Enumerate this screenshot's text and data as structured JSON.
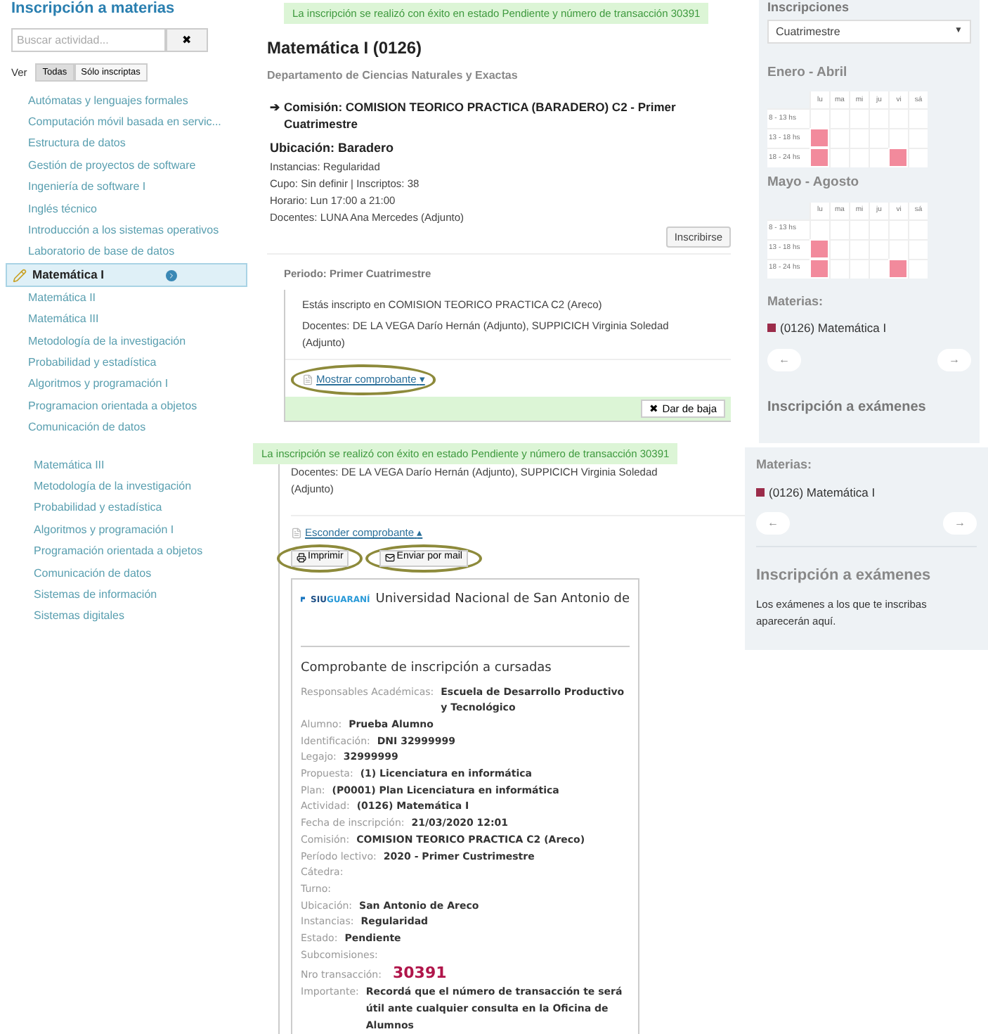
{
  "top": {
    "page_title": "Inscripción a materias",
    "search": {
      "placeholder": "Buscar actividad...",
      "clear": "✖"
    },
    "filter": {
      "label": "Ver",
      "options": [
        {
          "label": "Todas",
          "selected": true
        },
        {
          "label": "Sólo inscriptas",
          "selected": false
        }
      ]
    },
    "subjects": [
      {
        "label": "Autómatas y lenguajes formales",
        "selected": false
      },
      {
        "label": "Computación móvil basada en servic...",
        "selected": false
      },
      {
        "label": "Estructura de datos",
        "selected": false
      },
      {
        "label": "Gestión de proyectos de software",
        "selected": false
      },
      {
        "label": "Ingeniería de software I",
        "selected": false
      },
      {
        "label": "Inglés técnico",
        "selected": false
      },
      {
        "label": "Introducción a los sistemas operativos",
        "selected": false
      },
      {
        "label": "Laboratorio de base de datos",
        "selected": false
      },
      {
        "label": "Matemática I",
        "selected": true
      },
      {
        "label": "Matemática II",
        "selected": false
      },
      {
        "label": "Matemática III",
        "selected": false
      },
      {
        "label": "Metodología de la investigación",
        "selected": false
      },
      {
        "label": "Probabilidad y estadística",
        "selected": false
      },
      {
        "label": "Algoritmos y programación I",
        "selected": false
      },
      {
        "label": "Programacion orientada a objetos",
        "selected": false
      },
      {
        "label": "Comunicación de datos",
        "selected": false
      }
    ],
    "banner": "La inscripción se realizó con éxito en estado Pendiente y número de transacción 30391",
    "course": {
      "title": "Matemática I (0126)",
      "department": "Departamento de Ciencias Naturales y Exactas",
      "commission": {
        "arrow": "➔",
        "title": "Comisión: COMISION TEORICO PRACTICA (BARADERO) C2 - Primer Cuatrimestre",
        "location": "Ubicación: Baradero",
        "details": [
          "Instancias: Regularidad",
          "Cupo: Sin definir | Inscriptos: 38",
          "Horario: Lun 17:00 a 21:00",
          "Docentes: LUNA Ana Mercedes (Adjunto)"
        ],
        "button": "Inscribirse"
      },
      "period": "Periodo: Primer Cuatrimestre",
      "enrolled": {
        "lines": [
          "Estás inscripto en COMISION TEORICO PRACTICA C2 (Areco)",
          "Docentes: DE LA VEGA Darío Hernán (Adjunto), SUPPICICH Virginia Soledad (Adjunto)"
        ],
        "toggle": "Mostrar comprobante",
        "toggle_caret": "▾",
        "drop_icon": "✖",
        "drop_button": "Dar de baja"
      }
    },
    "schedule": {
      "heading": "Inscripciones",
      "select": "Cuatrimestre",
      "select_caret": "▼",
      "calendars": [
        {
          "title": "Enero - Abril",
          "days": [
            "lu",
            "ma",
            "mi",
            "ju",
            "vi",
            "sá"
          ],
          "rows": [
            {
              "label": "8 - 13 hs",
              "cells": [
                false,
                false,
                false,
                false,
                false,
                false
              ]
            },
            {
              "label": "13 - 18 hs",
              "cells": [
                true,
                false,
                false,
                false,
                false,
                false
              ]
            },
            {
              "label": "18 - 24 hs",
              "cells": [
                true,
                false,
                false,
                false,
                true,
                false
              ]
            }
          ]
        },
        {
          "title": "Mayo - Agosto",
          "days": [
            "lu",
            "ma",
            "mi",
            "ju",
            "vi",
            "sá"
          ],
          "rows": [
            {
              "label": "8 - 13 hs",
              "cells": [
                false,
                false,
                false,
                false,
                false,
                false
              ]
            },
            {
              "label": "13 - 18 hs",
              "cells": [
                true,
                false,
                false,
                false,
                false,
                false
              ]
            },
            {
              "label": "18 - 24 hs",
              "cells": [
                true,
                false,
                false,
                false,
                true,
                false
              ]
            }
          ]
        }
      ],
      "subjects_label": "Materias:",
      "legend": [
        {
          "label": "(0126) Matemática I",
          "color": "#9b2c4a"
        }
      ],
      "prev": "←",
      "next": "→",
      "exams_heading": "Inscripción a exámenes"
    }
  },
  "bottom": {
    "subjects": [
      {
        "label": "Matemática III"
      },
      {
        "label": "Metodología de la investigación"
      },
      {
        "label": "Probabilidad y estadística"
      },
      {
        "label": "Algoritmos y programación I"
      },
      {
        "label": "Programación orientada a objetos"
      },
      {
        "label": "Comunicación de datos"
      },
      {
        "label": "Sistemas de información"
      },
      {
        "label": "Sistemas digitales"
      }
    ],
    "banner": "La inscripción se realizó con éxito en estado Pendiente y número de transacción 30391",
    "teachers": "Docentes: DE LA VEGA Darío Hernán (Adjunto), SUPPICICH Virginia Soledad (Adjunto)",
    "toggle": "Esconder comprobante",
    "toggle_caret": "▴",
    "print_button": "Imprimir",
    "mail_button": "Enviar por mail",
    "receipt": {
      "logo": [
        "SIU",
        "GUARANÍ"
      ],
      "university": "Universidad Nacional de San Antonio de",
      "title": "Comprobante de inscripción a cursadas",
      "fields": [
        {
          "label": "Responsables Académicas:",
          "value": "Escuela de Desarrollo Productivo y Tecnológico",
          "kind": "plain"
        },
        {
          "label": "Alumno:",
          "value": "Prueba Alumno",
          "kind": "plain"
        },
        {
          "label": "Identificación:",
          "value": "DNI 32999999",
          "kind": "plain"
        },
        {
          "label": "Legajo:",
          "value": "32999999",
          "kind": "plain"
        },
        {
          "label": "Propuesta:",
          "value": "(1) Licenciatura en informática",
          "kind": "plain"
        },
        {
          "label": "Plan:",
          "value": "(P0001) Plan Licenciatura en informática",
          "kind": "plain"
        },
        {
          "label": "Actividad:",
          "value": "(0126) Matemática I",
          "kind": "plain"
        },
        {
          "label": "Fecha de inscripción:",
          "value": "21/03/2020 12:01",
          "kind": "plain"
        },
        {
          "label": "Comisión:",
          "value": "COMISION TEORICO PRACTICA C2 (Areco)",
          "kind": "plain"
        },
        {
          "label": "Período lectivo:",
          "value": "2020 - Primer Custrimestre",
          "kind": "plain"
        },
        {
          "label": "Cátedra:",
          "kind": "plain"
        },
        {
          "label": "Turno:",
          "kind": "plain"
        },
        {
          "label": "Ubicación:",
          "value": "San Antonio de Areco",
          "kind": "plain"
        },
        {
          "label": "Instancias:",
          "value": "Regularidad",
          "kind": "plain"
        },
        {
          "label": "Estado:",
          "value": "Pendiente",
          "kind": "plain"
        },
        {
          "label": "Subcomisiones:",
          "kind": "plain"
        },
        {
          "label": "Nro transacción:",
          "value": "30391",
          "kind": "transaction"
        },
        {
          "label": "Importante:",
          "value": "Recordá que el número de transacción te será útil ante cualquier consulta en la Oficina de Alumnos",
          "kind": "plain"
        }
      ]
    },
    "side": {
      "subjects_label": "Materias:",
      "legend": [
        {
          "label": "(0126) Matemática I",
          "color": "#9b2c4a"
        }
      ],
      "prev": "←",
      "next": "→",
      "exams_heading": "Inscripción a exámenes",
      "exams_text": "Los exámenes a los que te inscribas aparecerán aquí."
    }
  }
}
